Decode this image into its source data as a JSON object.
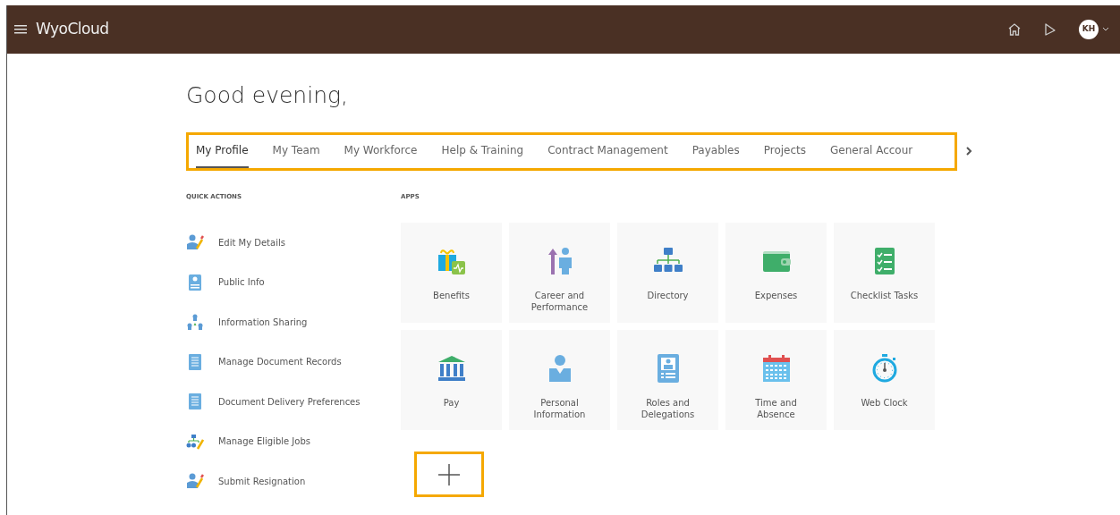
{
  "header": {
    "brand": "WyoCloud",
    "avatar": "KH"
  },
  "greeting": "Good evening,",
  "tabs": {
    "highlighted": true,
    "items": [
      {
        "label": "My Profile",
        "selected": true
      },
      {
        "label": "My Team",
        "selected": false
      },
      {
        "label": "My Workforce",
        "selected": false
      },
      {
        "label": "Help & Training",
        "selected": false
      },
      {
        "label": "Contract Management",
        "selected": false
      },
      {
        "label": "Payables",
        "selected": false
      },
      {
        "label": "Projects",
        "selected": false
      },
      {
        "label": "General Accour",
        "selected": false
      }
    ]
  },
  "quick_actions": {
    "title": "QUICK ACTIONS",
    "items": [
      {
        "label": "Edit My Details"
      },
      {
        "label": "Public Info"
      },
      {
        "label": "Information Sharing"
      },
      {
        "label": "Manage Document Records"
      },
      {
        "label": "Document Delivery Preferences"
      },
      {
        "label": "Manage Eligible Jobs"
      },
      {
        "label": "Submit Resignation"
      }
    ]
  },
  "apps": {
    "title": "APPS",
    "items": [
      {
        "label": "Benefits"
      },
      {
        "label": "Career and Performance"
      },
      {
        "label": "Directory"
      },
      {
        "label": "Expenses"
      },
      {
        "label": "Checklist Tasks"
      },
      {
        "label": "Pay"
      },
      {
        "label": "Personal Information"
      },
      {
        "label": "Roles and Delegations"
      },
      {
        "label": "Time and Absence"
      },
      {
        "label": "Web Clock"
      }
    ]
  },
  "add_button": {
    "highlighted": true
  }
}
